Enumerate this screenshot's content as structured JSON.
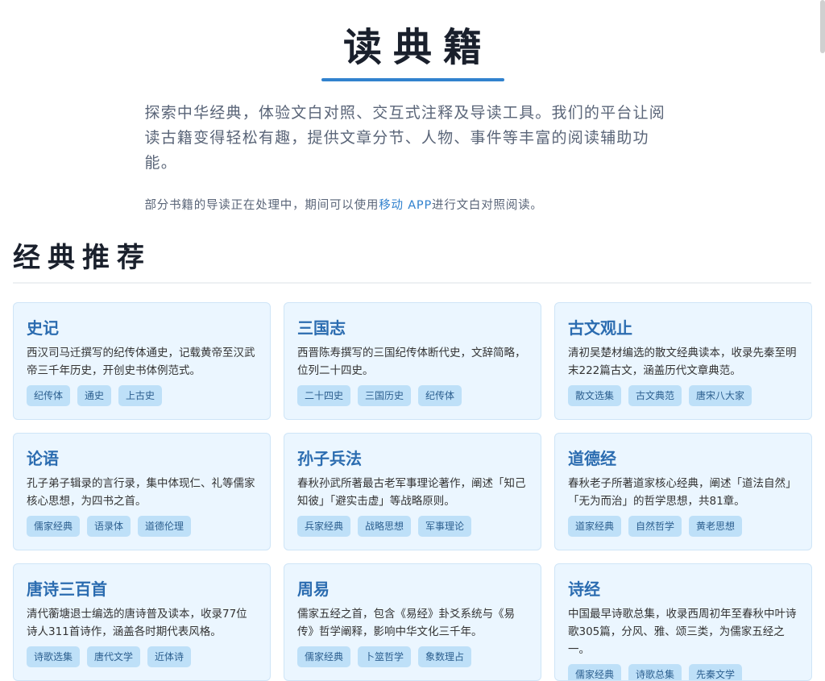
{
  "header": {
    "title": "读典籍",
    "intro": "探索中华经典，体验文白对照、交互式注释及导读工具。我们的平台让阅读古籍变得轻松有趣，提供文章分节、人物、事件等丰富的阅读辅助功能。",
    "note_before": "部分书籍的导读正在处理中，期间可以使用",
    "note_link": "移动 APP",
    "note_after": "进行文白对照阅读。"
  },
  "section": {
    "title": "经典推荐"
  },
  "books": [
    {
      "title": "史记",
      "desc": "西汉司马迁撰写的纪传体通史，记载黄帝至汉武帝三千年历史，开创史书体例范式。",
      "tags": [
        "纪传体",
        "通史",
        "上古史"
      ]
    },
    {
      "title": "三国志",
      "desc": "西晋陈寿撰写的三国纪传体断代史，文辞简略，位列二十四史。",
      "tags": [
        "二十四史",
        "三国历史",
        "纪传体"
      ]
    },
    {
      "title": "古文观止",
      "desc": "清初吴楚材编选的散文经典读本，收录先秦至明末222篇古文，涵盖历代文章典范。",
      "tags": [
        "散文选集",
        "古文典范",
        "唐宋八大家"
      ]
    },
    {
      "title": "论语",
      "desc": "孔子弟子辑录的言行录，集中体现仁、礼等儒家核心思想，为四书之首。",
      "tags": [
        "儒家经典",
        "语录体",
        "道德伦理"
      ]
    },
    {
      "title": "孙子兵法",
      "desc": "春秋孙武所著最古老军事理论著作，阐述「知己知彼」「避实击虚」等战略原则。",
      "tags": [
        "兵家经典",
        "战略思想",
        "军事理论"
      ]
    },
    {
      "title": "道德经",
      "desc": "春秋老子所著道家核心经典，阐述「道法自然」「无为而治」的哲学思想，共81章。",
      "tags": [
        "道家经典",
        "自然哲学",
        "黄老思想"
      ]
    },
    {
      "title": "唐诗三百首",
      "desc": "清代蘅塘退士编选的唐诗普及读本，收录77位诗人311首诗作，涵盖各时期代表风格。",
      "tags": [
        "诗歌选集",
        "唐代文学",
        "近体诗"
      ]
    },
    {
      "title": "周易",
      "desc": "儒家五经之首，包含《易经》卦爻系统与《易传》哲学阐释，影响中华文化三千年。",
      "tags": [
        "儒家经典",
        "卜筮哲学",
        "象数理占"
      ]
    },
    {
      "title": "诗经",
      "desc": "中国最早诗歌总集，收录西周初年至春秋中叶诗歌305篇，分风、雅、颂三类，为儒家五经之一。",
      "tags": [
        "儒家经典",
        "诗歌总集",
        "先秦文学"
      ]
    }
  ]
}
